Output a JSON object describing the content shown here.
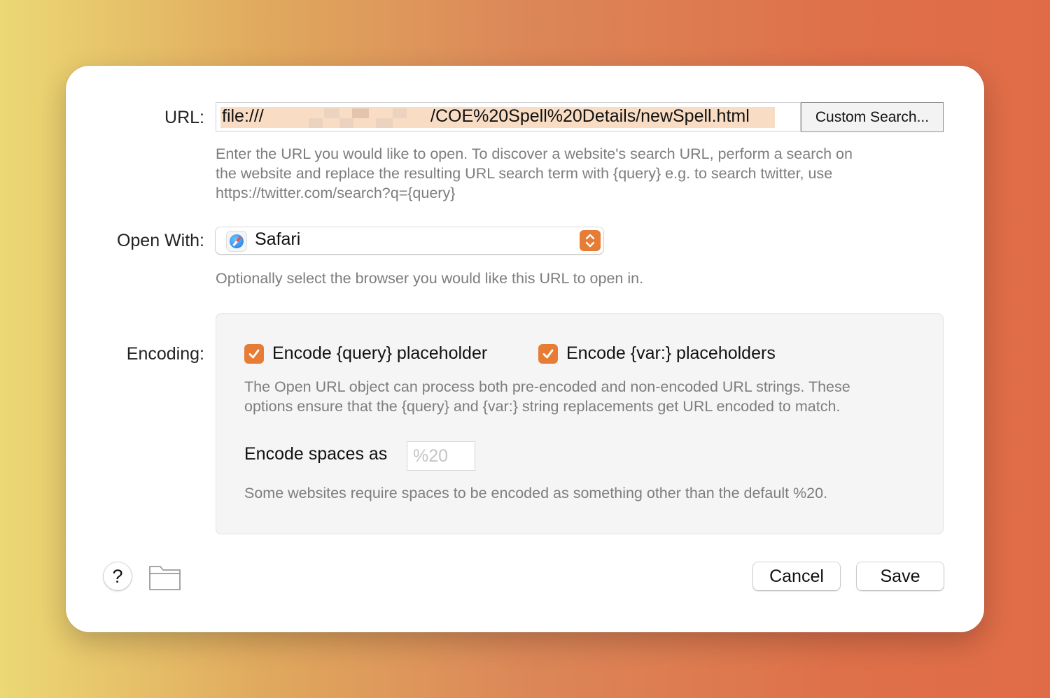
{
  "url_row": {
    "label": "URL:",
    "value_prefix": "file:///",
    "value_suffix": "/COE%20Spell%20Details/newSpell.html",
    "custom_search_label": "Custom Search...",
    "help_lines": [
      "Enter the URL you would like to open. To discover a website's search URL, perform a search on",
      "the website and replace the resulting URL search term with {query} e.g. to search twitter, use",
      "https://twitter.com/search?q={query}"
    ]
  },
  "open_with": {
    "label": "Open With:",
    "selected": "Safari",
    "icon": "safari-icon",
    "help": "Optionally select the browser you would like this URL to open in."
  },
  "encoding": {
    "label": "Encoding:",
    "query_checkbox": {
      "label": "Encode {query} placeholder",
      "checked": true
    },
    "var_checkbox": {
      "label": "Encode {var:} placeholders",
      "checked": true
    },
    "help_lines": [
      "The Open URL object can process both pre-encoded and non-encoded URL strings. These",
      "options ensure that the {query} and {var:} string replacements get URL encoded to match."
    ],
    "spaces_label": "Encode spaces as",
    "spaces_placeholder": "%20",
    "spaces_help": "Some websites require spaces to be encoded as something other than the default %20."
  },
  "footer": {
    "help_glyph": "?",
    "folder_icon": "folder-icon",
    "cancel_label": "Cancel",
    "save_label": "Save"
  },
  "colors": {
    "accent": "#e77c35",
    "url_highlight": "#f9dcc4"
  }
}
